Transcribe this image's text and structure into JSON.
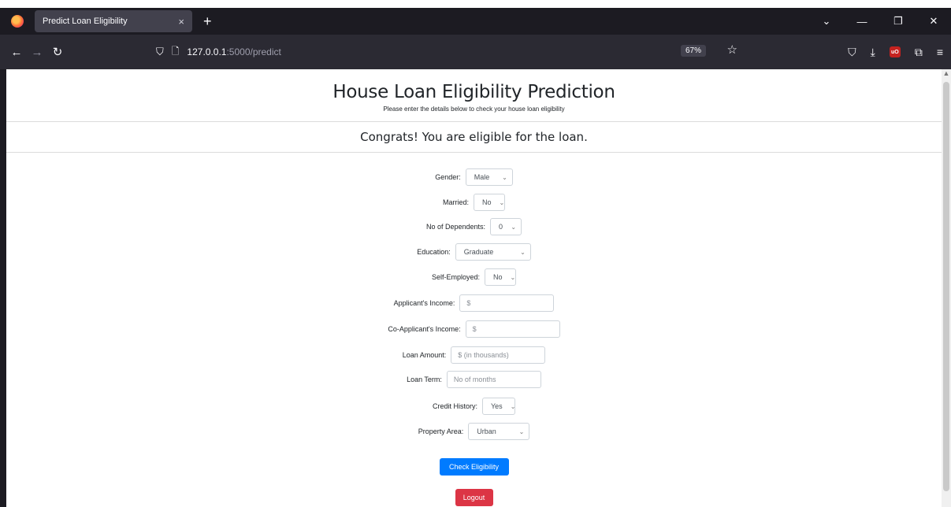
{
  "browser": {
    "tab_title": "Predict Loan Eligibility",
    "tab_close": "×",
    "new_tab": "+",
    "url_host": "127.0.0.1",
    "url_path": ":5000/predict",
    "zoom": "67%"
  },
  "page": {
    "title": "House Loan Eligibility Prediction",
    "subtitle": "Please enter the details below to check your house loan eligibility",
    "result": "Congrats! You are eligible for the loan."
  },
  "form": {
    "gender": {
      "label": "Gender:",
      "value": "Male"
    },
    "married": {
      "label": "Married:",
      "value": "No"
    },
    "dependents": {
      "label": "No of Dependents:",
      "value": "0"
    },
    "education": {
      "label": "Education:",
      "value": "Graduate"
    },
    "self_employed": {
      "label": "Self-Employed:",
      "value": "No"
    },
    "applicant_income": {
      "label": "Applicant's Income:",
      "placeholder": "$"
    },
    "coapplicant_income": {
      "label": "Co-Applicant's Income:",
      "placeholder": "$"
    },
    "loan_amount": {
      "label": "Loan Amount:",
      "placeholder": "$ (in thousands)"
    },
    "loan_term": {
      "label": "Loan Term:",
      "placeholder": "No of months"
    },
    "credit_history": {
      "label": "Credit History:",
      "value": "Yes"
    },
    "property_area": {
      "label": "Property Area:",
      "value": "Urban"
    }
  },
  "buttons": {
    "check": "Check Eligibility",
    "logout": "Logout"
  }
}
